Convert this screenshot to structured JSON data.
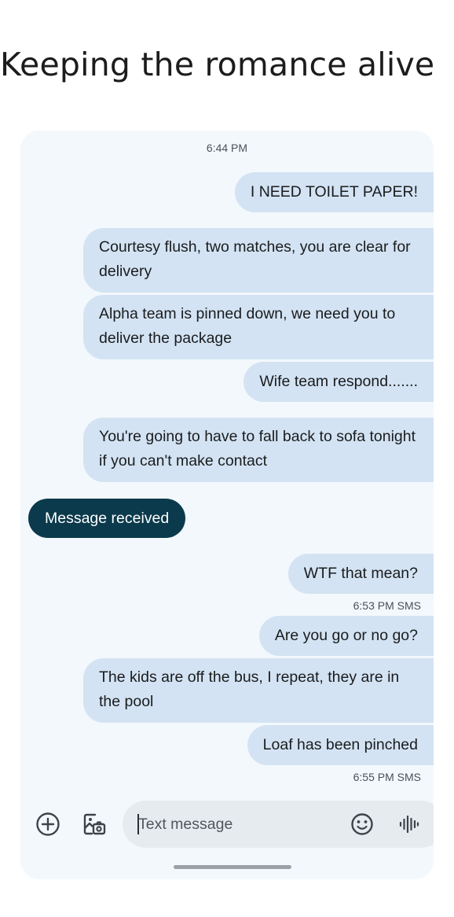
{
  "headline": "Keeping the romance alive",
  "conversation": {
    "timestamp_top": "6:44 PM",
    "messages": [
      {
        "text": "I NEED TOILET PAPER!",
        "side": "outgoing"
      },
      {
        "text": "Courtesy flush, two matches, you are clear for delivery",
        "side": "outgoing"
      },
      {
        "text": "Alpha team is pinned down, we need you to deliver the package",
        "side": "outgoing"
      },
      {
        "text": "Wife team respond.......",
        "side": "outgoing"
      },
      {
        "text": "You're going to have to fall back to sofa tonight if you can't make contact",
        "side": "outgoing"
      },
      {
        "text": "Message received",
        "side": "incoming"
      },
      {
        "text": "WTF that mean?",
        "side": "outgoing"
      },
      {
        "text": "Are you go or no go?",
        "side": "outgoing"
      },
      {
        "text": "The kids are off the bus, I repeat, they are in the pool",
        "side": "outgoing"
      },
      {
        "text": "Loaf has been pinched",
        "side": "outgoing"
      }
    ],
    "status_1": "6:53 PM SMS",
    "status_2": "6:55 PM SMS"
  },
  "compose": {
    "placeholder": "Text message",
    "icons": [
      "add-icon",
      "gallery-icon",
      "emoji-icon",
      "voice-icon"
    ]
  },
  "colors": {
    "outgoing_bubble": "#d3e3f3",
    "incoming_bubble": "#0b3a4c",
    "background": "#f3f8fc"
  }
}
